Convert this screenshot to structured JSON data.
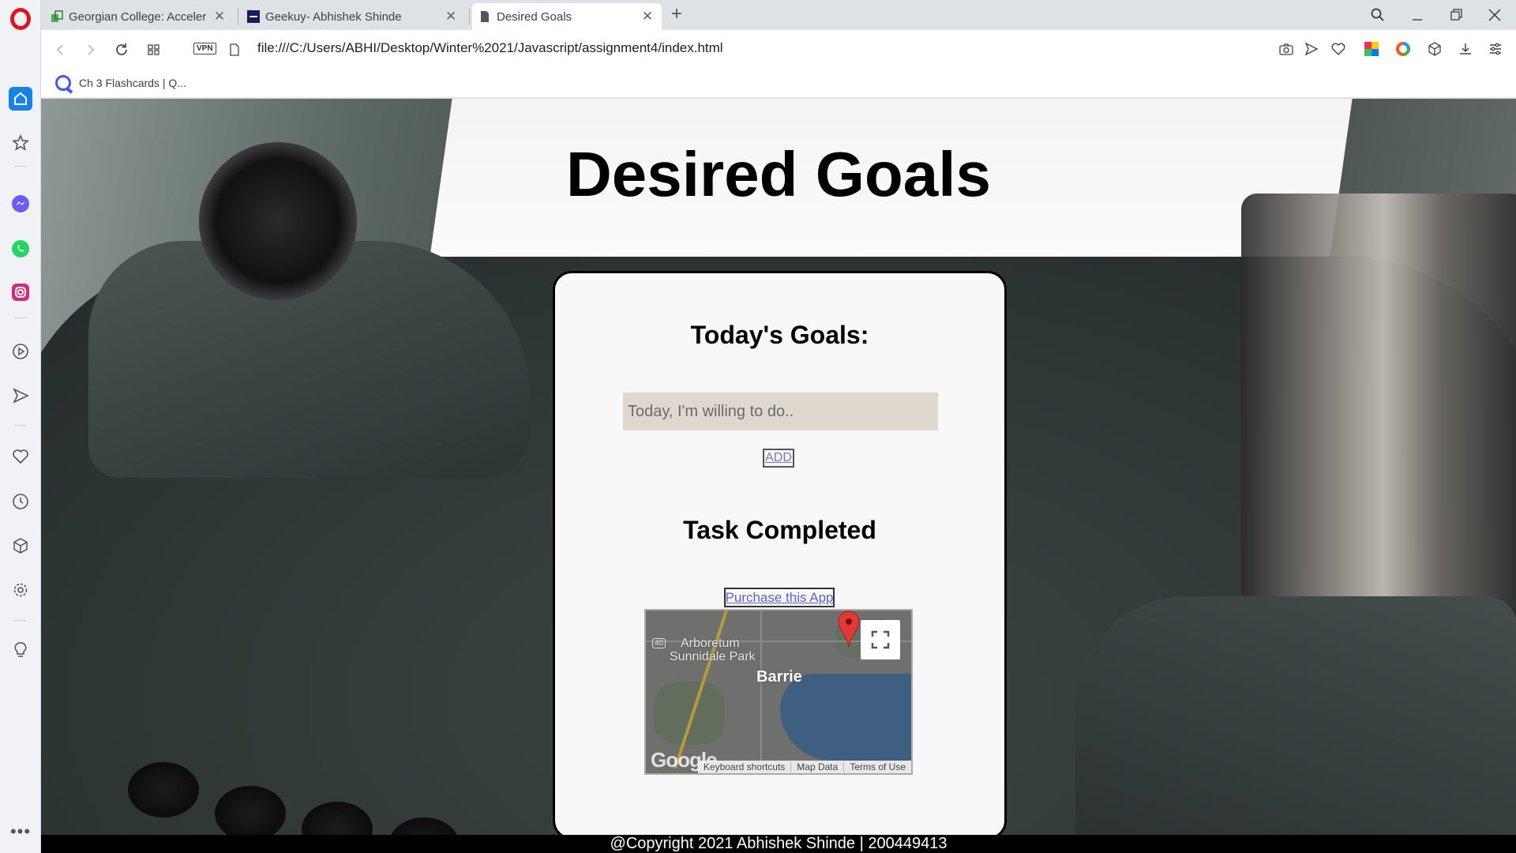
{
  "browser": {
    "tabs": [
      {
        "title": "Georgian College: Accelera",
        "active": false
      },
      {
        "title": "Geekuy- Abhishek Shinde",
        "active": false
      },
      {
        "title": "Desired Goals",
        "active": true
      }
    ],
    "address": {
      "vpn_label": "VPN",
      "url": "file:///C:/Users/ABHI/Desktop/Winter%2021/Javascript/assignment4/index.html"
    },
    "bookmarks": [
      {
        "label": "Ch 3 Flashcards | Q..."
      }
    ]
  },
  "page": {
    "title": "Desired Goals",
    "goals_heading": "Today's Goals:",
    "goal_input_placeholder": "Today, I'm willing to do..",
    "goal_input_value": "",
    "add_button": "ADD",
    "completed_heading": "Task Completed",
    "purchase_link": "Purchase this App",
    "map": {
      "highway_number": "40",
      "park_label_1": "Arboretum",
      "park_label_2": "Sunnidale Park",
      "city_label": "Barrie",
      "logo_text": "Google",
      "footer_links": [
        "Keyboard shortcuts",
        "Map Data",
        "Terms of Use"
      ]
    },
    "footer": "@Copyright 2021 Abhishek Shinde | 200449413"
  },
  "colors": {
    "opera_red": "#e1141e",
    "home_blue": "#1683ec",
    "input_bg": "#ded8cd",
    "link": "#5b62d6",
    "map_pin": "#e53935"
  }
}
